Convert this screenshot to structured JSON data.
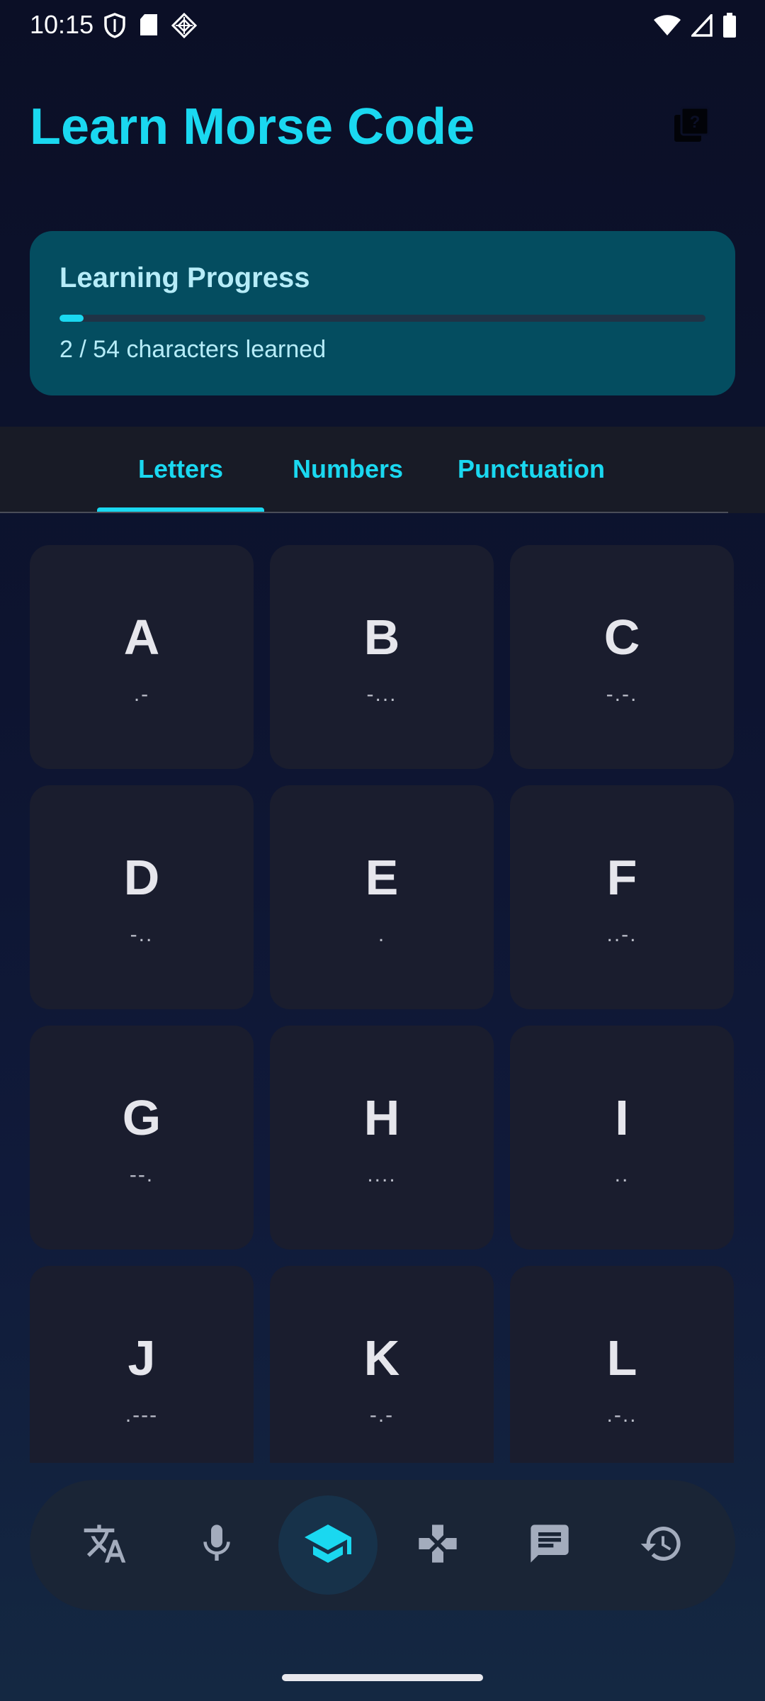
{
  "status_bar": {
    "time": "10:15",
    "icons": [
      "shield-icon",
      "sd-card-icon",
      "diamond-grid-icon",
      "wifi-icon",
      "signal-icon",
      "battery-icon"
    ]
  },
  "header": {
    "title": "Learn Morse Code",
    "help_icon": "quiz-help-icon"
  },
  "progress": {
    "title": "Learning Progress",
    "learned": 2,
    "total": 54,
    "text": "2 / 54 characters learned",
    "fraction": 0.037
  },
  "tabs": [
    {
      "label": "Letters",
      "selected": true
    },
    {
      "label": "Numbers",
      "selected": false
    },
    {
      "label": "Punctuation",
      "selected": false
    }
  ],
  "characters": [
    {
      "char": "A",
      "code": ".-"
    },
    {
      "char": "B",
      "code": "-..."
    },
    {
      "char": "C",
      "code": "-.-."
    },
    {
      "char": "D",
      "code": "-.."
    },
    {
      "char": "E",
      "code": "."
    },
    {
      "char": "F",
      "code": "..-."
    },
    {
      "char": "G",
      "code": "--."
    },
    {
      "char": "H",
      "code": "...."
    },
    {
      "char": "I",
      "code": ".."
    },
    {
      "char": "J",
      "code": ".---"
    },
    {
      "char": "K",
      "code": "-.-"
    },
    {
      "char": "L",
      "code": ".-.."
    }
  ],
  "bottom_nav": [
    {
      "icon": "translate-icon",
      "active": false
    },
    {
      "icon": "microphone-icon",
      "active": false
    },
    {
      "icon": "graduation-cap-icon",
      "active": true
    },
    {
      "icon": "gamepad-icon",
      "active": false
    },
    {
      "icon": "chat-icon",
      "active": false
    },
    {
      "icon": "history-icon",
      "active": false
    }
  ],
  "colors": {
    "accent": "#1ad8f0",
    "card": "#1a1d2e",
    "progress_card": "#044d60",
    "inactive_icon": "#a3acbd"
  }
}
